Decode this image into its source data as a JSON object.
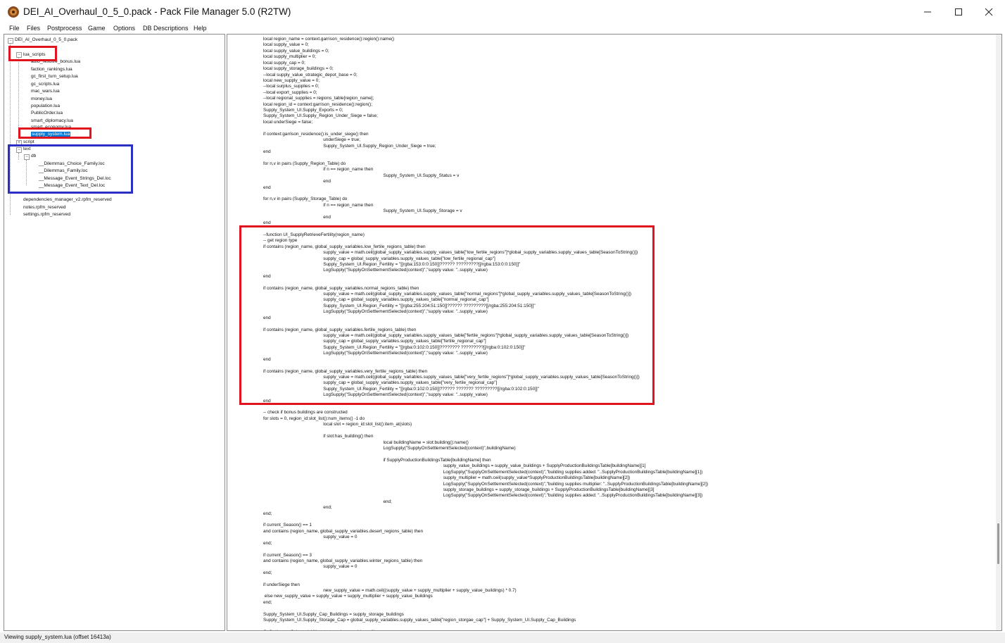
{
  "window": {
    "title": "DEI_AI_Overhaul_0_5_0.pack - Pack File Manager 5.0 (R2TW)",
    "icon": "app-icon",
    "controls": [
      "minimize-icon",
      "maximize-icon",
      "close-icon"
    ]
  },
  "menu": {
    "items": [
      "File",
      "Files",
      "Postprocess",
      "Game",
      "Options",
      "DB Descriptions",
      "Help"
    ]
  },
  "tree": {
    "root": "DEI_AI_Overhaul_0_5_0.pack",
    "lua_scripts": "lua_scripts",
    "lua_files": [
      "auto_resolve_bonus.lua",
      "faction_rankings.lua",
      "gc_first_turn_setup.lua",
      "gc_scripts.lua",
      "mac_wars.lua",
      "money.lua",
      "population.lua",
      "PublicOrder.lua",
      "smart_diplomacy.lua",
      "smart_economy.lua",
      "supply_system.lua"
    ],
    "script": "script",
    "text": "text",
    "db": "db",
    "db_files": [
      "__Dilemmas_Choice_Family.loc",
      "__Dilemmas_Family.loc",
      "__Message_Event_Strings_Del.loc",
      "__Message_Event_Text_Del.loc"
    ],
    "root_files": [
      "dependencies_manager_v2.rpfm_reserved",
      "notes.rpfm_reserved",
      "settings.rpfm_reserved"
    ]
  },
  "code_lines": [
    "local region_name = context.garrison_residence():region():name()",
    "local supply_value = 0;",
    "local supply_value_buildings = 0;",
    "local supply_multiplier = 0;",
    "local supply_cap = 0;",
    "local supply_storage_buildings = 0;",
    "--local supply_value_strategic_depot_base = 0;",
    "local new_supply_value = 0;",
    "--local surplus_supplies = 0;",
    "--local export_supplies = 0;",
    "--local regional_supplies = regions_table[region_name];",
    "local region_id = context:garrison_residence():region();",
    "Supply_System_UI.Supply_Exports = 0;",
    "Supply_System_UI.Supply_Region_Under_Siege = false;",
    "local underSiege = false;",
    "",
    "if context:garrison_residence():is_under_siege() then",
    "\t\t\t\tunderSiege = true;",
    "\t\t\t\tSupply_System_UI.Supply_Region_Under_Siege = true;",
    "end",
    "",
    "for n,v in pairs (Supply_Region_Table) do",
    "\t\t\t\tif n == region_name then",
    "\t\t\t\t\t\t\t\tSupply_System_UI.Supply_Status = v",
    "\t\t\t\tend",
    "end",
    "",
    "for n,v in pairs (Supply_Storage_Table) do",
    "\t\t\t\tif n == region_name then",
    "\t\t\t\t\t\t\t\tSupply_System_UI.Supply_Storage = v",
    "\t\t\t\tend",
    "end",
    "",
    "--function UI_SupplyRetrieveFertility(region_name)",
    "-- get region type",
    "if contains (region_name, global_supply_variables.low_fertile_regions_table) then",
    "\t\t\t\tsupply_value = math.ceil(global_supply_variables.supply_values_table[\"low_fertile_regions\"]*global_supply_variables.supply_values_table[SeasonToString()])",
    "\t\t\t\tsupply_cap = global_supply_variables.supply_values_table[\"low_fertile_regional_cap\"]",
    "\t\t\t\tSupply_System_UI.Region_Fertility = \"[[rgba:153:0:0:150]]?????? ?????????[[/rgba:153:0:0:150]]\"",
    "\t\t\t\tLogSupply(\"SupplyOnSettlementSelected(context)\",\"supply value: \"..supply_value)",
    "end",
    "",
    "if contains (region_name, global_supply_variables.normal_regions_table) then",
    "\t\t\t\tsupply_value = math.ceil(global_supply_variables.supply_values_table[\"normal_regions\"]*global_supply_variables.supply_values_table[SeasonToString()])",
    "\t\t\t\tsupply_cap = global_supply_variables.supply_values_table[\"normal_regional_cap\"]",
    "\t\t\t\tSupply_System_UI.Region_Fertility = \"[[rgba:255:204:51:150]]?????? ?????????[[/rgba:255:204:51:150]]\"",
    "\t\t\t\tLogSupply(\"SupplyOnSettlementSelected(context)\",\"supply value: \"..supply_value)",
    "end",
    "",
    "if contains (region_name, global_supply_variables.fertile_regions_table) then",
    "\t\t\t\tsupply_value = math.ceil(global_supply_variables.supply_values_table[\"fertile_regions\"]*global_supply_variables.supply_values_table[SeasonToString()])",
    "\t\t\t\tsupply_cap = global_supply_variables.supply_values_table[\"fertile_regional_cap\"]",
    "\t\t\t\tSupply_System_UI.Region_Fertility = \"[[rgba:0:102:0:150]]???????? ?????????[[/rgba:0:102:0:150]]\"",
    "\t\t\t\tLogSupply(\"SupplyOnSettlementSelected(context)\",\"supply value: \"..supply_value)",
    "end",
    "",
    "if contains (region_name, global_supply_variables.very_fertile_regions_table) then",
    "\t\t\t\tsupply_value = math.ceil(global_supply_variables.supply_values_table[\"very_fertile_regions\"]*global_supply_variables.supply_values_table[SeasonToString()])",
    "\t\t\t\tsupply_cap = global_supply_variables.supply_values_table[\"very_fertile_regional_cap\"]",
    "\t\t\t\tSupply_System_UI.Region_Fertility = \"[[rgba:0:102:0:150]]?????? ??????? ?????????[[/rgba:0:102:0:150]]\"",
    "\t\t\t\tLogSupply(\"SupplyOnSettlementSelected(context)\",\"supply value: \"..supply_value)",
    "end",
    "",
    "-- check if bonus buildings are constructed",
    "for slots = 0, region_id:slot_list():num_items() -1 do",
    "\t\t\t\tlocal slot = region_id:slot_list():item_at(slots)",
    "",
    "\t\t\t\tif slot:has_building() then",
    "\t\t\t\t\t\t\t\tlocal buildingName = slot:building():name()",
    "\t\t\t\t\t\t\t\tLogSupply(\"SupplyOnSettlementSelected(context)\",buildingName)",
    "",
    "\t\t\t\t\t\t\t\tif SupplyProductionBuildingsTable[buildingName] then",
    "\t\t\t\t\t\t\t\t\t\t\t\tsupply_value_buildings = supply_value_buildings + SupplyProductionBuildingsTable[buildingName][1]",
    "\t\t\t\t\t\t\t\t\t\t\t\tLogSupply(\"SupplyOnSettlementSelected(context)\",\"building supplies added: \"..SupplyProductionBuildingsTable[buildingName][1])",
    "\t\t\t\t\t\t\t\t\t\t\t\tsupply_multiplier = math.ceil(supply_value*SupplyProductionBuildingsTable[buildingName][2])",
    "\t\t\t\t\t\t\t\t\t\t\t\tLogSupply(\"SupplyOnSettlementSelected(context)\",\"building supplies multiplier: \"..SupplyProductionBuildingsTable[buildingName][2])",
    "\t\t\t\t\t\t\t\t\t\t\t\tsupply_storage_buildings = supply_storage_buildings + SupplyProductionBuildingsTable[buildingName][3]",
    "\t\t\t\t\t\t\t\t\t\t\t\tLogSupply(\"SupplyOnSettlementSelected(context)\",\"building supplies added: \"..SupplyProductionBuildingsTable[buildingName][3])",
    "\t\t\t\t\t\t\t\tend;",
    "\t\t\t\tend;",
    "end;",
    "",
    "if current_Season() == 1",
    "and contains (region_name, global_supply_variables.desert_regions_table) then",
    "\t\t\t\tsupply_value = 0",
    "end;",
    "",
    "if current_Season() == 3",
    "and contains (region_name, global_supply_variables.winter_regions_table) then",
    "\t\t\t\tsupply_value = 0",
    "end;",
    "",
    "if underSiege then",
    "\t\t\t\tnew_supply_value = math.ceil((supply_value + supply_multiplier + supply_value_buildings) * 0.7)",
    " else new_supply_value = supply_value + supply_multiplier + supply_value_buildings",
    "end;",
    "",
    "Supply_System_UI.Supply_Cap_Buildings = supply_storage_buildings",
    "Supply_System_UI.Supply_Storage_Cap = global_supply_variables.supply_values_table[\"region_storgae_cap\"] + Supply_System_UI.Supply_Cap_Buildings",
    "",
    "OnSettlementSelected_UI(context:garrison_residence())"
  ],
  "status": "Viewing supply_system.lua (offset 16413a)",
  "colors": {
    "annotation_red": "#e0141e",
    "annotation_blue": "#2b2fc2",
    "selection": "#0078d7"
  }
}
